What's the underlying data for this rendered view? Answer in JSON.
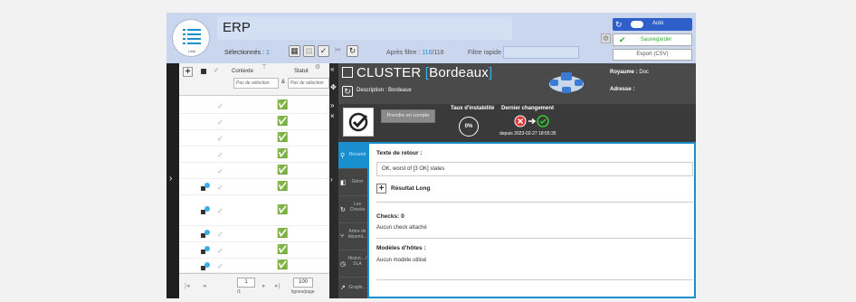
{
  "app": {
    "title": "ERP",
    "logo_label": "Liste",
    "selected_label": "Sélectionnés :",
    "selected_count": "1",
    "after_filter_label": "Après filtre :",
    "after_filter_count": "116",
    "after_filter_total": "/116",
    "quick_filter_label": "Filtre rapide",
    "quick_filter_value": "",
    "auto_label": "Auto",
    "save_label": "Sauvegarder",
    "export_label": "Export (CSV)"
  },
  "table": {
    "col_context": "Contexte",
    "col_status": "Statut",
    "filter_context": "Pas de sélection",
    "filter_and": "&",
    "filter_status": "Pas de sélection",
    "page_value": "1",
    "page_total": "/1",
    "page_size": "100",
    "page_size_label": "lignes/page"
  },
  "detail": {
    "title_prefix": "CLUSTER",
    "title_open": "[",
    "title_name": "Bordeaux",
    "title_close": "]",
    "description": "Description : Bordeaux",
    "royaume_label": "Royaume :",
    "royaume_value": "Doc",
    "adresse_label": "Adresse :",
    "prendre_label": "Prendre en compte",
    "instability_label": "Taux d'instabilité",
    "instability_value": "0%",
    "last_change_label": "Dernier changement",
    "since_label": "depuis 2023-02-27 18:55:35"
  },
  "tabs": {
    "resume": "Résumé",
    "gerer": "Gérer",
    "checks": "Les Checks",
    "arbre": "Arbre de dépend...",
    "histo": "Histori... / SLA",
    "graph": "Graphi..."
  },
  "content": {
    "return_label": "Texte de retour :",
    "return_value": "OK, worst of [3 OK] states",
    "long_result_label": "Résultat Long",
    "checks_label": "Checks: 0",
    "checks_value": "Aucun check attaché",
    "models_label": "Modèles d'hôtes :",
    "models_value": "Aucun modèle utilisé"
  }
}
